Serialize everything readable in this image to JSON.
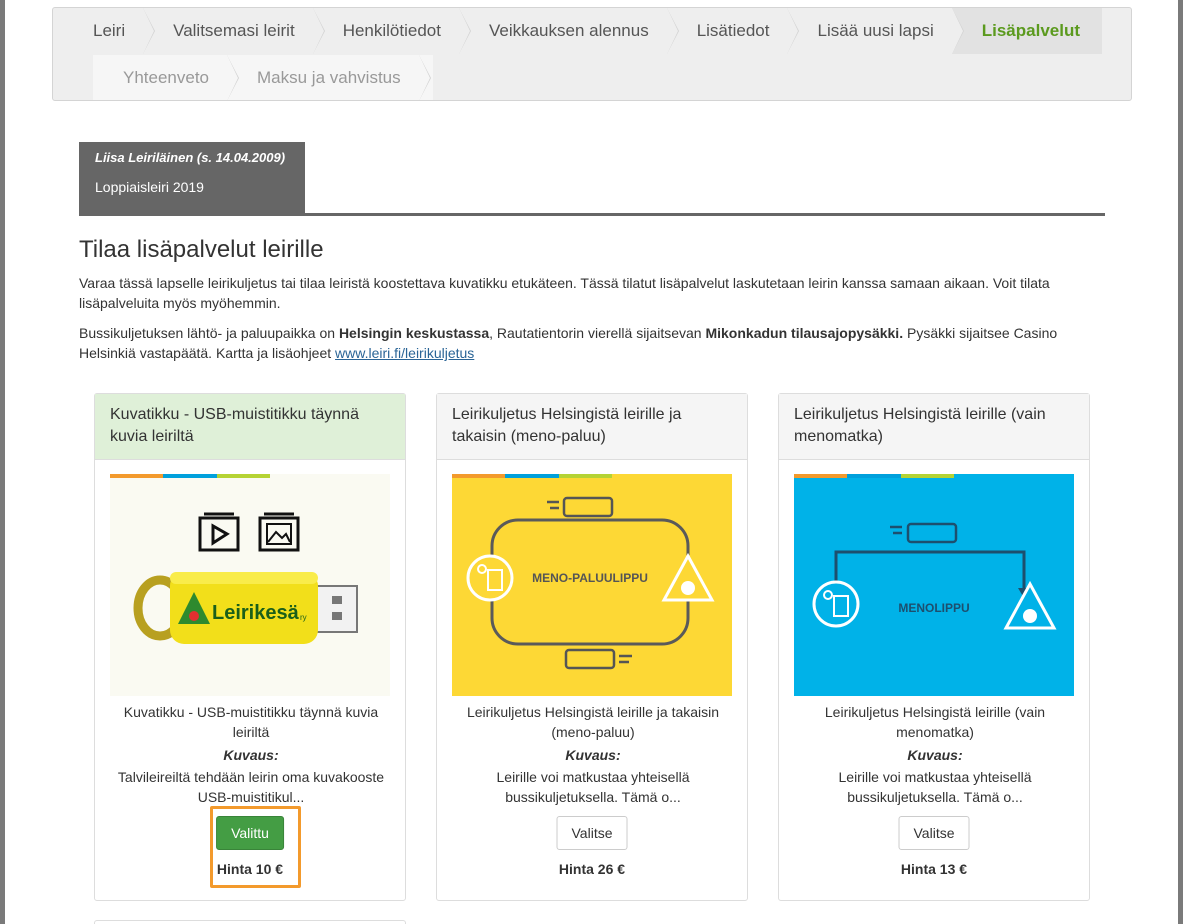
{
  "wizard": {
    "steps": [
      {
        "label": "Leiri"
      },
      {
        "label": "Valitsemasi leirit"
      },
      {
        "label": "Henkilötiedot"
      },
      {
        "label": "Veikkauksen alennus"
      },
      {
        "label": "Lisätiedot"
      },
      {
        "label": "Lisää uusi lapsi"
      },
      {
        "label": "Lisäpalvelut"
      },
      {
        "label": "Yhteenveto"
      },
      {
        "label": "Maksu ja vahvistus"
      }
    ],
    "active_step": "Lisäpalvelut"
  },
  "child": {
    "name": "Liisa Leiriläinen (s. 14.04.2009)",
    "camp": "Loppiaisleiri 2019"
  },
  "page": {
    "title": "Tilaa lisäpalvelut leirille",
    "intro": "Varaa tässä lapselle leirikuljetus tai tilaa leiristä koostettava kuvatikku etukäteen. Tässä tilatut lisäpalvelut laskutetaan leirin kanssa samaan aikaan. Voit tilata lisäpalveluita myös myöhemmin.",
    "bus_info": {
      "t1": "Bussikuljetuksen lähtö- ja paluupaikka on ",
      "b1": "Helsingin keskustassa",
      "t2": ", Rautatientorin vierellä sijaitsevan ",
      "b2": "Mikonkadun tilausajopysäkki.",
      "t3": " Pysäkki sijaitsee Casino Helsinkiä vastapäätä. Kartta ja lisäohjeet ",
      "link": "www.leiri.fi/leirikuljetus"
    }
  },
  "services": [
    {
      "header": "Kuvatikku - USB-muistitikku täynnä kuvia leiriltä",
      "title": "Kuvatikku - USB-muistitikku täynnä kuvia leiriltä",
      "desc_label": "Kuvaus:",
      "desc": "Talvileireiltä tehdään leirin oma kuvakooste USB-muistitikul...",
      "button": "Valittu",
      "price": "Hinta 10 €",
      "selected": true,
      "image": {
        "brand_text": "Leirikesä",
        "brand_suffix": "ry",
        "colors": [
          "#f39a2c",
          "#00a0dc",
          "#b5d334"
        ]
      }
    },
    {
      "header": "Leirikuljetus Helsingistä leirille ja takaisin (meno-paluu)",
      "title": "Leirikuljetus Helsingistä leirille ja takaisin (meno-paluu)",
      "desc_label": "Kuvaus:",
      "desc": "Leirille voi matkustaa yhteisellä bussikuljetuksella. Tämä o...",
      "button": "Valitse",
      "price": "Hinta 26 €",
      "selected": false,
      "image": {
        "label": "MENO-PALUULIPPU",
        "bg": "#fdd835"
      }
    },
    {
      "header": "Leirikuljetus Helsingistä leirille (vain menomatka)",
      "title": "Leirikuljetus Helsingistä leirille (vain menomatka)",
      "desc_label": "Kuvaus:",
      "desc": "Leirille voi matkustaa yhteisellä bussikuljetuksella. Tämä o...",
      "button": "Valitse",
      "price": "Hinta 13 €",
      "selected": false,
      "image": {
        "label": "MENOLIPPU",
        "bg": "#00b2e8"
      }
    }
  ]
}
